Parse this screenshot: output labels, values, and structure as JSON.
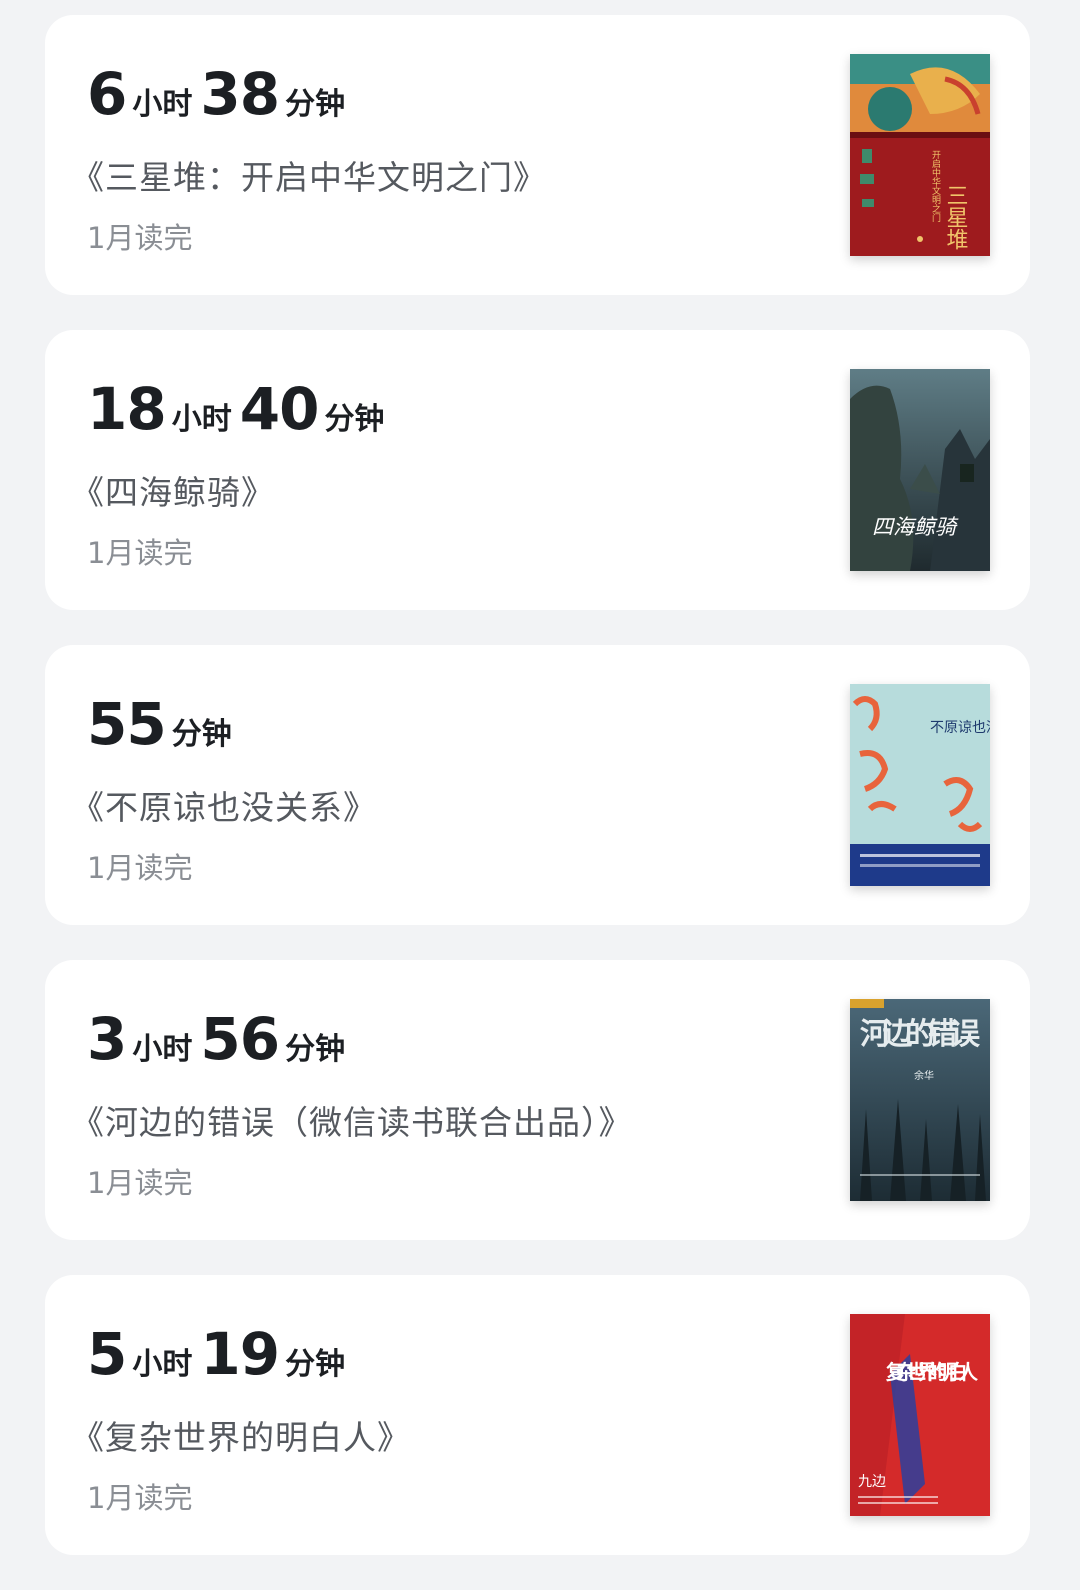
{
  "records": [
    {
      "time_parts": [
        {
          "num": "6",
          "unit": "小时"
        },
        {
          "num": "38",
          "unit": "分钟"
        }
      ],
      "title": "《三星堆：开启中华文明之门》",
      "status": "1月读完",
      "cover": {
        "main_color": "#9e1b1e",
        "accent": "#e8a34a",
        "cover_text": "三星堆",
        "cover_subtext": "开启中华文明之门"
      }
    },
    {
      "time_parts": [
        {
          "num": "18",
          "unit": "小时"
        },
        {
          "num": "40",
          "unit": "分钟"
        }
      ],
      "title": "《四海鲸骑》",
      "status": "1月读完",
      "cover": {
        "main_color": "#2f3e45",
        "accent": "#7d9aa3",
        "cover_text": "四海鲸骑"
      }
    },
    {
      "time_parts": [
        {
          "num": "55",
          "unit": "分钟"
        }
      ],
      "title": "《不原谅也没关系》",
      "status": "1月读完",
      "cover": {
        "main_color": "#a9d6d8",
        "accent": "#e8643c",
        "cover_text": "不原谅也没关系"
      }
    },
    {
      "time_parts": [
        {
          "num": "3",
          "unit": "小时"
        },
        {
          "num": "56",
          "unit": "分钟"
        }
      ],
      "title": "《河边的错误（微信读书联合出品）》",
      "status": "1月读完",
      "cover": {
        "main_color": "#2d4350",
        "accent": "#c9d3d8",
        "cover_text": "河边的错误",
        "cover_subtext": "余华"
      }
    },
    {
      "time_parts": [
        {
          "num": "5",
          "unit": "小时"
        },
        {
          "num": "19",
          "unit": "分钟"
        }
      ],
      "title": "《复杂世界的明白人》",
      "status": "1月读完",
      "cover": {
        "main_color": "#d42a2a",
        "accent": "#1e3a8a",
        "cover_text": "复杂世界的明白人",
        "cover_subtext": "九边"
      }
    }
  ]
}
